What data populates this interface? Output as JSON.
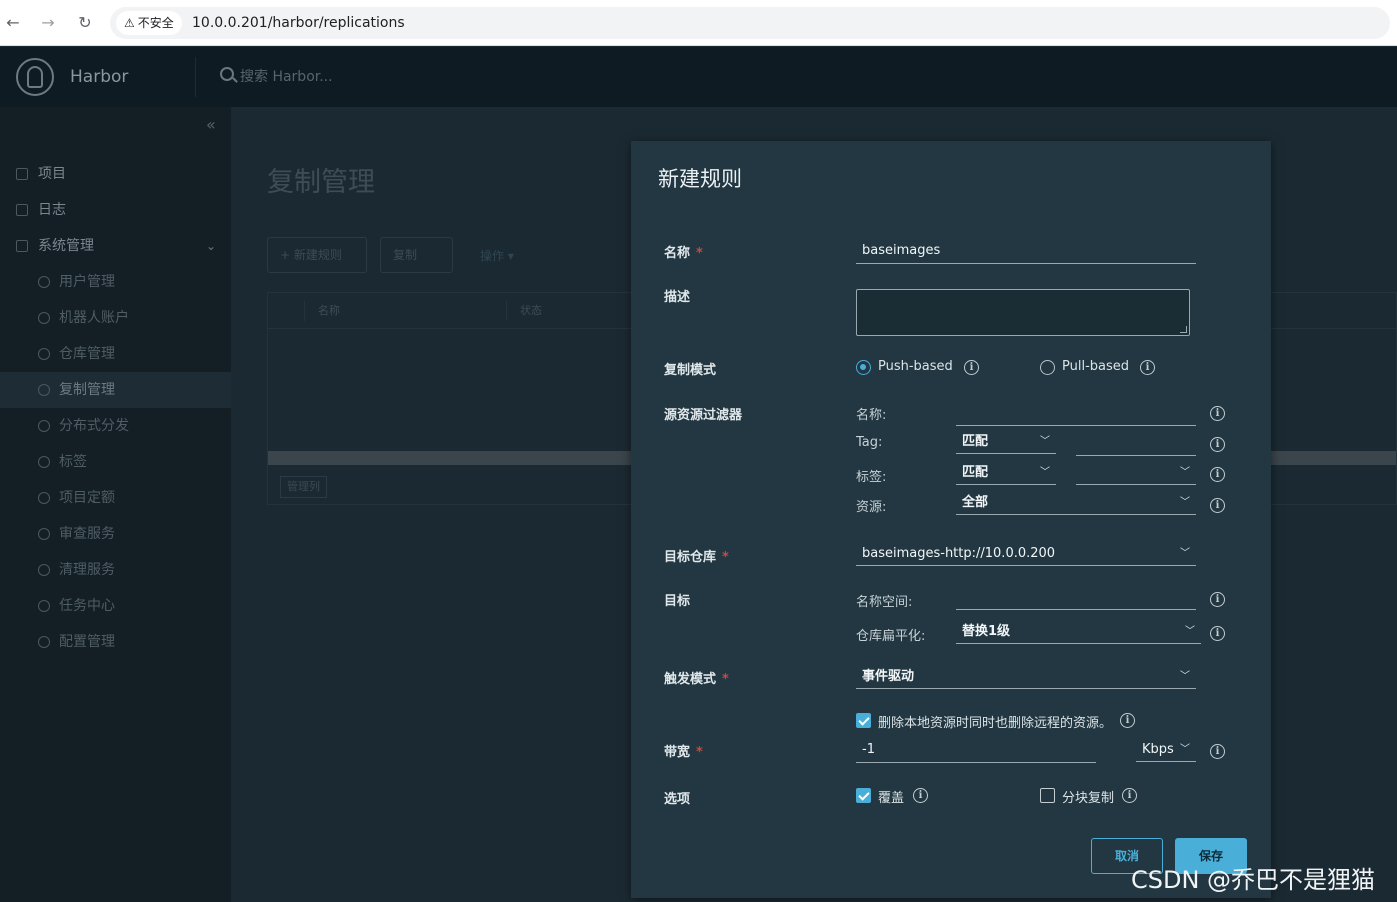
{
  "browser": {
    "back": "←",
    "forward": "→",
    "reload": "↻",
    "security_label": "不安全",
    "url": "10.0.0.201/harbor/replications"
  },
  "header": {
    "brand": "Harbor",
    "search_placeholder": "搜索 Harbor..."
  },
  "sidebar": {
    "collapse": "«",
    "items": [
      {
        "label": "项目"
      },
      {
        "label": "日志"
      },
      {
        "label": "系统管理"
      }
    ],
    "sub_items": [
      {
        "label": "用户管理"
      },
      {
        "label": "机器人账户"
      },
      {
        "label": "仓库管理"
      },
      {
        "label": "复制管理"
      },
      {
        "label": "分布式分发"
      },
      {
        "label": "标签"
      },
      {
        "label": "项目定额"
      },
      {
        "label": "审查服务"
      },
      {
        "label": "清理服务"
      },
      {
        "label": "任务中心"
      },
      {
        "label": "配置管理"
      }
    ]
  },
  "main": {
    "title": "复制管理",
    "new_rule_btn": "+ 新建规则",
    "copy_btn": "复制",
    "action_link": "操作 ▾",
    "columns": [
      "名称",
      "状态"
    ],
    "manage_cols_btn": "管理列"
  },
  "modal": {
    "title": "新建规则",
    "name_label": "名称",
    "name_value": "baseimages",
    "desc_label": "描述",
    "mode_label": "复制模式",
    "push_label": "Push-based",
    "pull_label": "Pull-based",
    "filter_label": "源资源过滤器",
    "filter_name_label": "名称:",
    "filter_tag_label": "Tag:",
    "filter_tag_value": "匹配",
    "filter_label_label": "标签:",
    "filter_label_value": "匹配",
    "filter_res_label": "资源:",
    "filter_res_value": "全部",
    "dest_repo_label": "目标仓库",
    "dest_repo_value": "baseimages-http://10.0.0.200",
    "target_label": "目标",
    "namespace_label": "名称空间:",
    "flatten_label": "仓库扁平化:",
    "flatten_value": "替换1级",
    "trigger_label": "触发模式",
    "trigger_value": "事件驱动",
    "delete_remote_text": "删除本地资源时同时也删除远程的资源。",
    "bandwidth_label": "带宽",
    "bandwidth_value": "-1",
    "bandwidth_unit": "Kbps",
    "options_label": "选项",
    "override_label": "覆盖",
    "chunk_label": "分块复制",
    "cancel": "取消",
    "save": "保存",
    "required_mark": "*",
    "info_glyph": "i"
  },
  "watermark": "CSDN @乔巴不是狸猫",
  "colors": {
    "accent": "#49afd9",
    "modal_bg": "#223741",
    "required": "#c94a3f"
  }
}
